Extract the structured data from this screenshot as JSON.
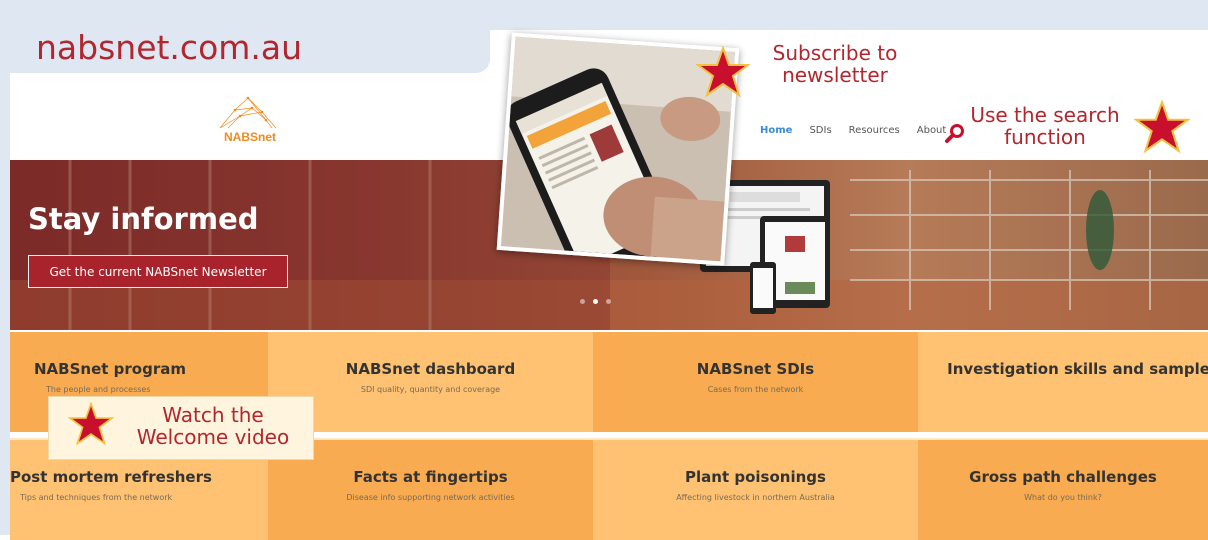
{
  "site": {
    "title": "nabsnet.com.au"
  },
  "logo": {
    "text_nabs": "NABS",
    "text_net": "net"
  },
  "nav": {
    "items": [
      "Home",
      "SDIs",
      "Resources",
      "About"
    ]
  },
  "hero": {
    "title": "Stay informed",
    "button": "Get the current NABSnet Newsletter"
  },
  "annotations": {
    "subscribe": "Subscribe to\nnewsletter",
    "search": "Use the search\nfunction",
    "welcome": "Watch the\nWelcome video"
  },
  "tiles": [
    {
      "title": "NABSnet program",
      "subtitle": "The people and processes"
    },
    {
      "title": "NABSnet dashboard",
      "subtitle": "SDI quality, quantity and coverage"
    },
    {
      "title": "NABSnet SDIs",
      "subtitle": "Cases from the network"
    },
    {
      "title": "Investigation skills and samples",
      "subtitle": ""
    },
    {
      "title": "Post mortem refreshers",
      "subtitle": "Tips and techniques from the network"
    },
    {
      "title": "Facts at fingertips",
      "subtitle": "Disease info supporting network activities"
    },
    {
      "title": "Plant poisonings",
      "subtitle": "Affecting livestock in northern Australia"
    },
    {
      "title": "Gross path challenges",
      "subtitle": "What do you think?"
    }
  ],
  "colors": {
    "accent": "#b3262d",
    "nav_active": "#3a8bd6",
    "tile_orange": "#f7a94d",
    "tile_light": "#ffc577",
    "frame": "#dfe7f3"
  },
  "icons": [
    "search-icon",
    "star-icon",
    "logo-network-icon"
  ]
}
